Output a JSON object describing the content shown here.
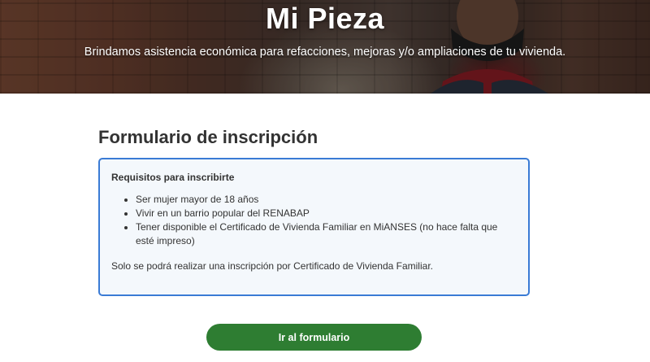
{
  "hero": {
    "title": "Mi Pieza",
    "subtitle": "Brindamos asistencia económica para refacciones, mejoras y/o ampliaciones de tu vivienda."
  },
  "form": {
    "title": "Formulario de inscripción"
  },
  "requirements": {
    "title": "Requisitos para inscribirte",
    "items": [
      "Ser mujer mayor de 18 años",
      "Vivir en un barrio popular del RENABAP",
      "Tener disponible el Certificado de Vivienda Familiar en MiANSES (no hace falta que esté impreso)"
    ],
    "note": "Solo se podrá realizar una inscripción por Certificado de Vivienda Familiar."
  },
  "cta": {
    "label": "Ir al formulario"
  },
  "colors": {
    "button": "#2e7d32",
    "box_border": "#3a7bd5",
    "box_background": "#f4f8fc"
  }
}
